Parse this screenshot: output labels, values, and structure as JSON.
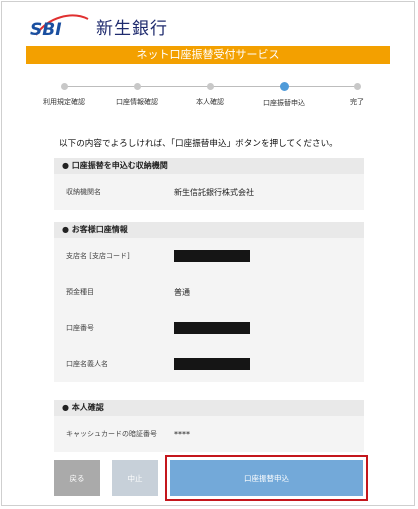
{
  "logo": {
    "mark": "SBI",
    "name": "新生銀行"
  },
  "banner": {
    "title": "ネット口座振替受付サービス"
  },
  "steps": [
    {
      "label": "利用規定確認",
      "active": false
    },
    {
      "label": "口座情報確認",
      "active": false
    },
    {
      "label": "本人確認",
      "active": false
    },
    {
      "label": "口座振替申込",
      "active": true
    },
    {
      "label": "完了",
      "active": false
    }
  ],
  "instruction": "以下の内容でよろしければ、「口座振替申込」ボタンを押してください。",
  "sections": {
    "biller": {
      "heading": "●  口座振替を申込む収納機関",
      "rows": [
        {
          "label": "収納機関名",
          "value": "新生信託銀行株式会社"
        }
      ]
    },
    "account": {
      "heading": "●  お客様口座情報",
      "rows": [
        {
          "label": "支店名 [支店コード]",
          "value": ""
        },
        {
          "label": "預金種目",
          "value": "普通"
        },
        {
          "label": "口座番号",
          "value": ""
        },
        {
          "label": "口座名義人名",
          "value": ""
        }
      ]
    },
    "identity": {
      "heading": "●  本人確認",
      "rows": [
        {
          "label": "キャッシュカードの暗証番号",
          "value": "****"
        }
      ]
    }
  },
  "buttons": {
    "back": "戻る",
    "stop": "中止",
    "apply": "口座振替申込"
  },
  "colors": {
    "banner": "#f3a000",
    "active_step": "#4f9bd9",
    "apply_button": "#73a9d9",
    "highlight": "#c4161c",
    "logo_blue": "#1a4fa0",
    "logo_red": "#e03030"
  }
}
